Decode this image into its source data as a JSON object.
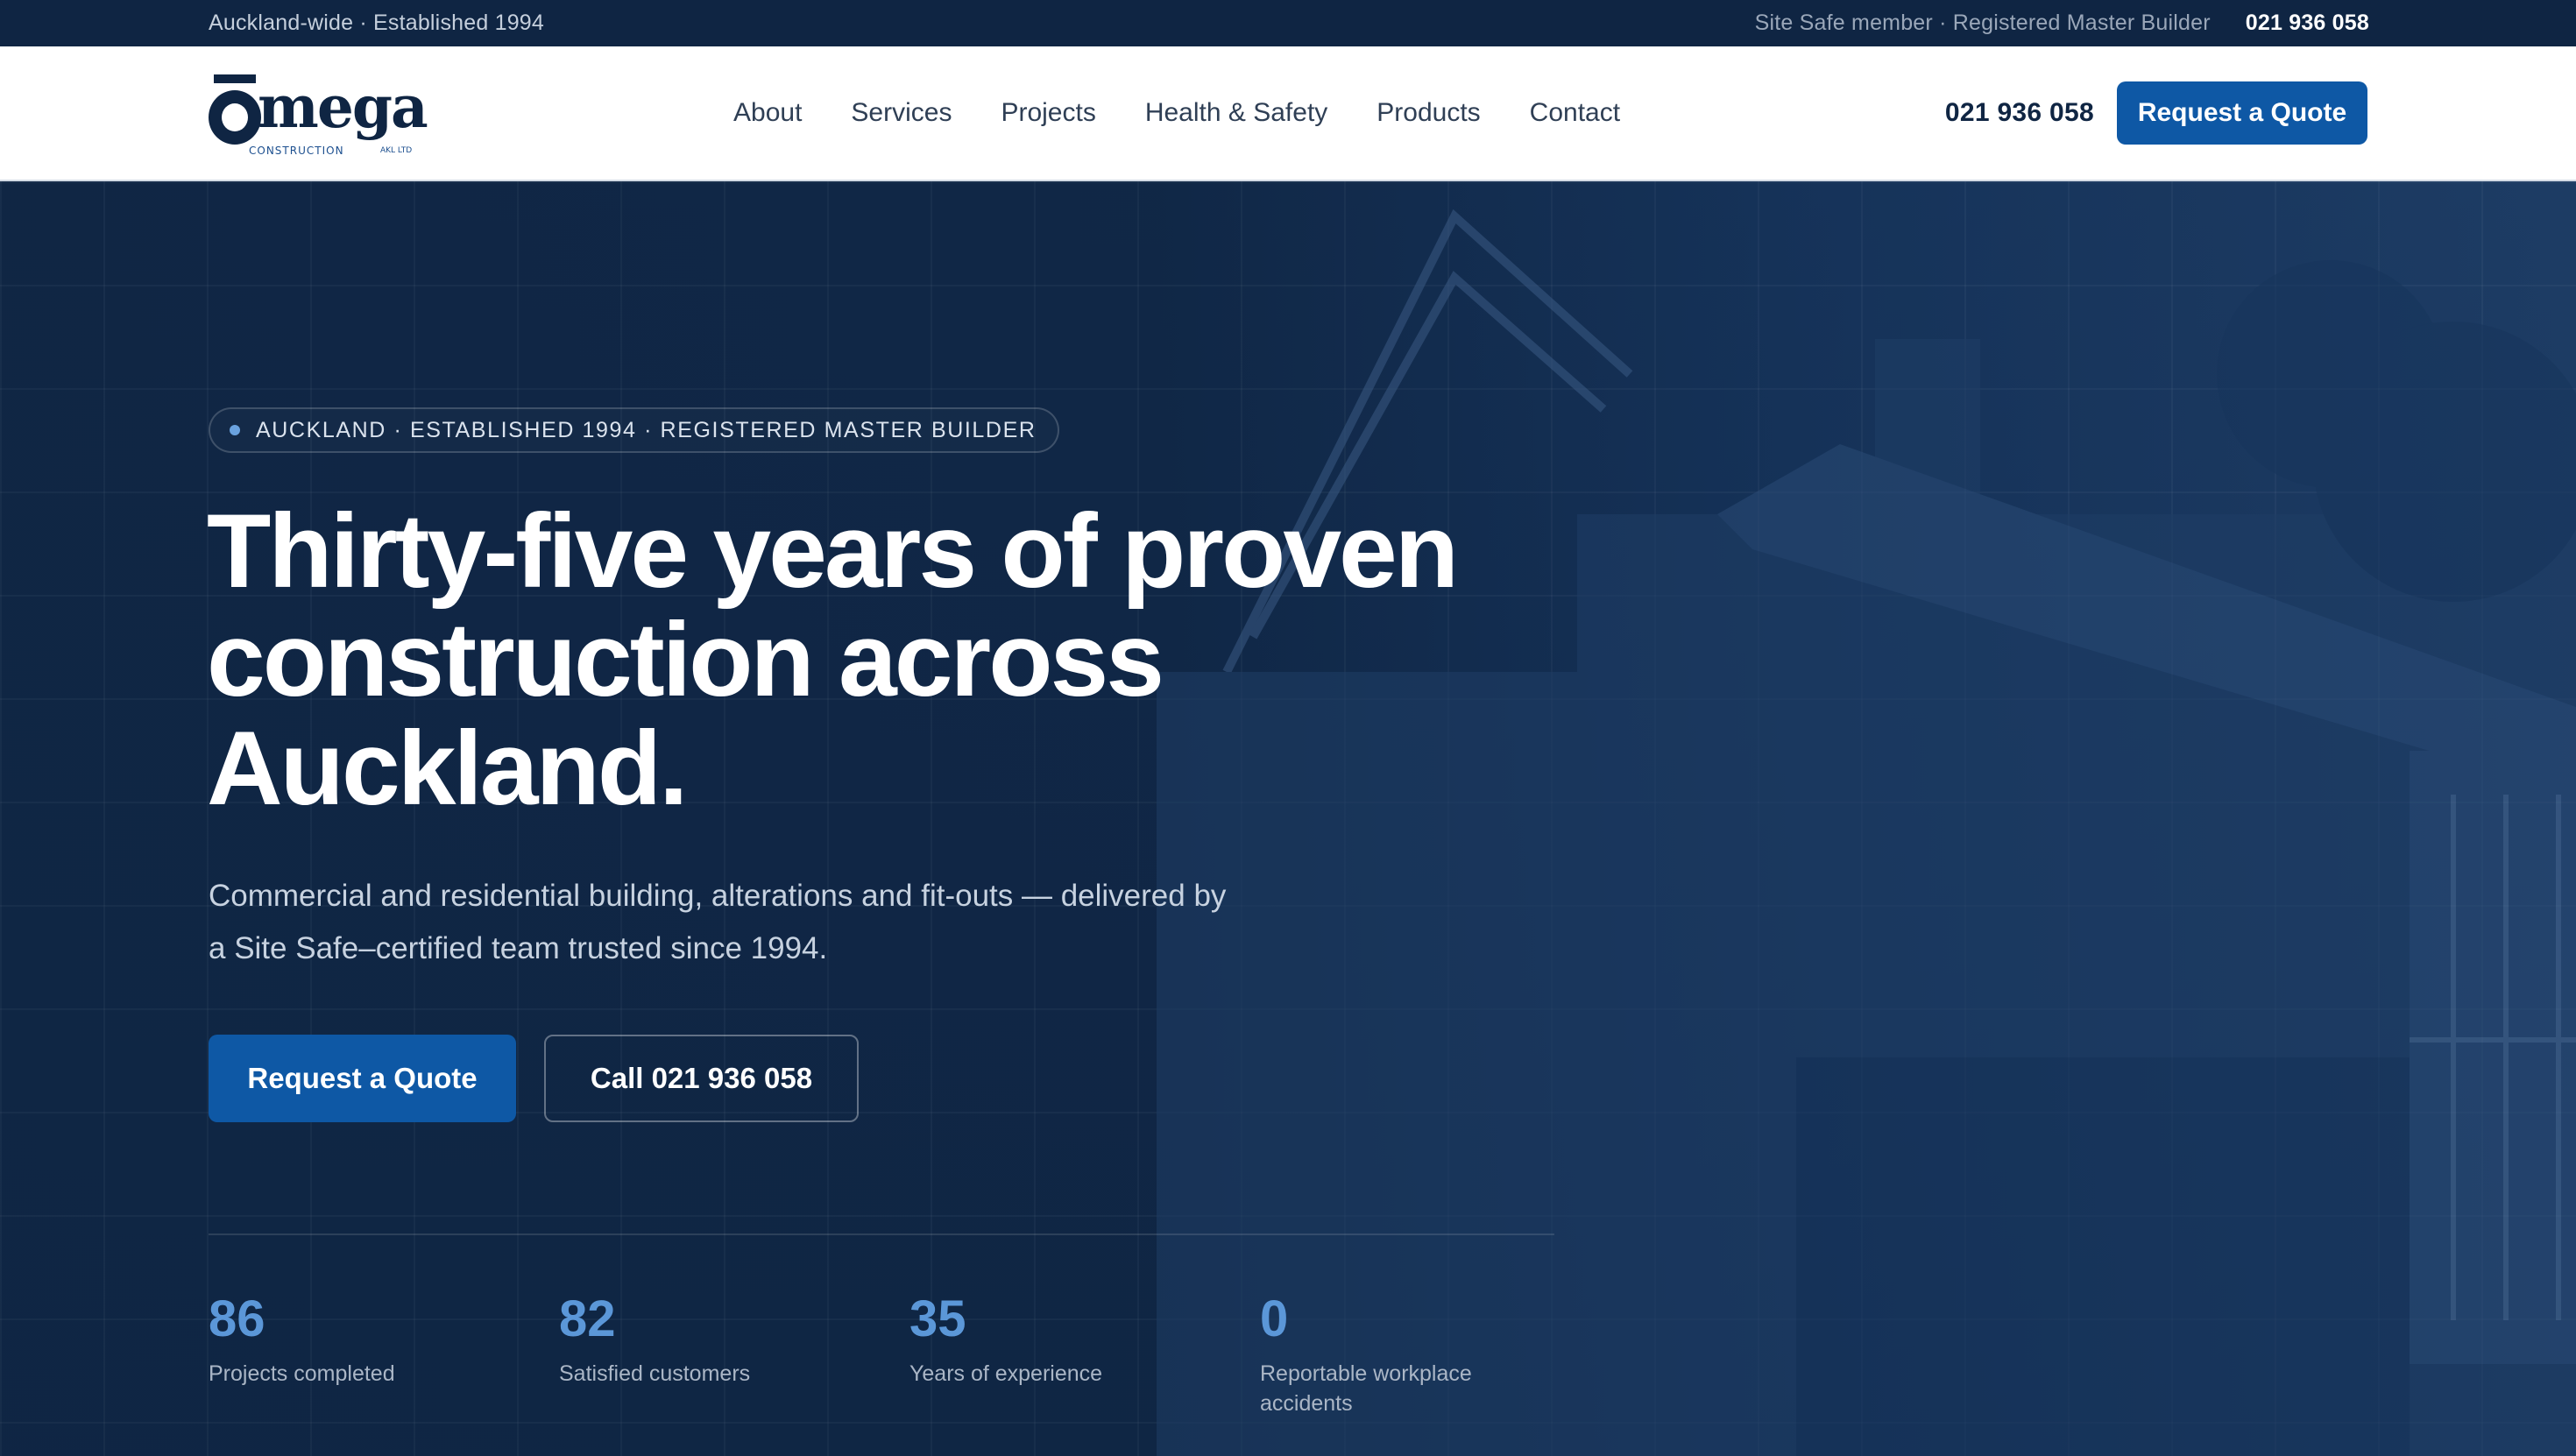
{
  "topbar": {
    "left_text": "Auckland-wide · Established 1994",
    "credentials": "Site Safe member · Registered Master Builder",
    "phone": "021 936 058"
  },
  "nav": {
    "logo": {
      "name": "Omega",
      "tagline": "CONSTRUCTION",
      "suffix": "AKL LTD"
    },
    "links": [
      "About",
      "Services",
      "Projects",
      "Health & Safety",
      "Products",
      "Contact"
    ],
    "phone": "021 936 058",
    "cta_label": "Request a Quote"
  },
  "hero": {
    "badge": "AUCKLAND · ESTABLISHED 1994 · REGISTERED MASTER BUILDER",
    "headline": "Thirty-five years of proven construction across Auckland.",
    "subtext": "Commercial and residential building, alterations and fit-outs — delivered by a Site Safe–certified team trusted since 1994.",
    "primary_cta": "Request a Quote",
    "secondary_cta": "Call 021 936 058",
    "stats": [
      {
        "value": "86",
        "label": "Projects completed"
      },
      {
        "value": "82",
        "label": "Satisfied customers"
      },
      {
        "value": "35",
        "label": "Years of experience"
      },
      {
        "value": "0",
        "label": "Reportable workplace accidents"
      }
    ]
  },
  "colors": {
    "navy": "#0f2543",
    "primary_blue": "#0e58a5",
    "stat_blue": "#5b97d8",
    "white": "#ffffff"
  }
}
